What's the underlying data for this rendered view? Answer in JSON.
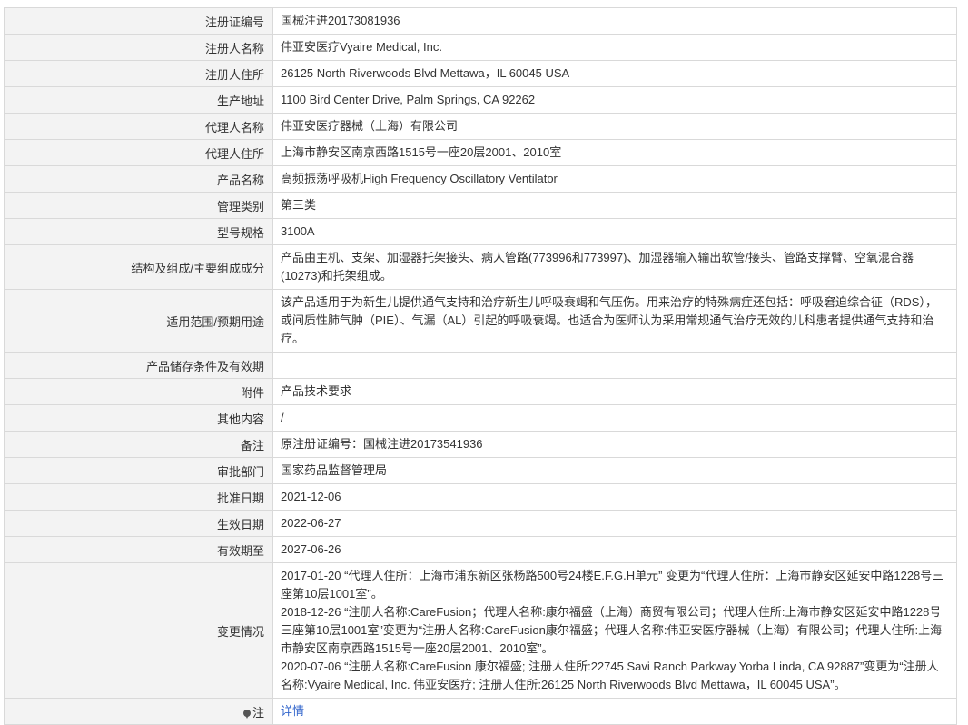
{
  "rows": [
    {
      "label": "注册证编号",
      "value": "国械注进20173081936"
    },
    {
      "label": "注册人名称",
      "value": "伟亚安医疗Vyaire Medical, Inc."
    },
    {
      "label": "注册人住所",
      "value": "26125 North Riverwoods Blvd Mettawa，IL 60045 USA"
    },
    {
      "label": "生产地址",
      "value": "1100 Bird Center Drive, Palm Springs, CA 92262"
    },
    {
      "label": "代理人名称",
      "value": "伟亚安医疗器械（上海）有限公司"
    },
    {
      "label": "代理人住所",
      "value": "上海市静安区南京西路1515号一座20层2001、2010室"
    },
    {
      "label": "产品名称",
      "value": "高频振荡呼吸机High Frequency Oscillatory Ventilator"
    },
    {
      "label": "管理类别",
      "value": "第三类"
    },
    {
      "label": "型号规格",
      "value": "3100A"
    },
    {
      "label": "结构及组成/主要组成成分",
      "value": "产品由主机、支架、加湿器托架接头、病人管路(773996和773997)、加湿器输入输出软管/接头、管路支撑臂、空氧混合器(10273)和托架组成。"
    },
    {
      "label": "适用范围/预期用途",
      "value": "该产品适用于为新生儿提供通气支持和治疗新生儿呼吸衰竭和气压伤。用来治疗的特殊病症还包括：呼吸窘迫综合征（RDS），或间质性肺气肿（PIE）、气漏（AL）引起的呼吸衰竭。也适合为医师认为采用常规通气治疗无效的儿科患者提供通气支持和治疗。"
    },
    {
      "label": "产品储存条件及有效期",
      "value": ""
    },
    {
      "label": "附件",
      "value": "产品技术要求"
    },
    {
      "label": "其他内容",
      "value": "/"
    },
    {
      "label": "备注",
      "value": "原注册证编号：国械注进20173541936"
    },
    {
      "label": "审批部门",
      "value": "国家药品监督管理局"
    },
    {
      "label": "批准日期",
      "value": "2021-12-06"
    },
    {
      "label": "生效日期",
      "value": "2022-06-27"
    },
    {
      "label": "有效期至",
      "value": "2027-06-26"
    }
  ],
  "changes": {
    "label": "变更情况",
    "entries": [
      "2017-01-20 “代理人住所：上海市浦东新区张杨路500号24楼E.F.G.H单元” 变更为“代理人住所：上海市静安区延安中路1228号三座第10层1001室”。",
      "2018-12-26 “注册人名称:CareFusion；代理人名称:康尔福盛（上海）商贸有限公司；代理人住所:上海市静安区延安中路1228号三座第10层1001室”变更为“注册人名称:CareFusion康尔福盛；代理人名称:伟亚安医疗器械（上海）有限公司；代理人住所:上海市静安区南京西路1515号一座20层2001、2010室”。",
      "2020-07-06 “注册人名称:CareFusion 康尔福盛; 注册人住所:22745 Savi Ranch Parkway Yorba Linda, CA 92887”变更为“注册人名称:Vyaire Medical, Inc. 伟亚安医疗; 注册人住所:26125 North Riverwoods Blvd Mettawa，IL 60045 USA”。"
    ]
  },
  "note": {
    "icon": "location-pin-icon",
    "label": "注",
    "link_text": "详情",
    "link_color": "#3366cc"
  }
}
